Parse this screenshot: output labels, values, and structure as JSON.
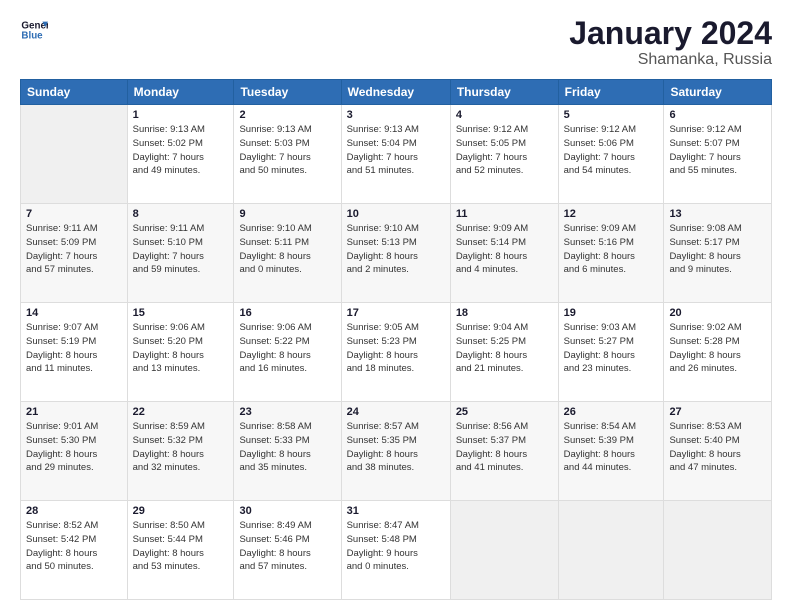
{
  "logo": {
    "line1": "General",
    "line2": "Blue"
  },
  "title": "January 2024",
  "subtitle": "Shamanka, Russia",
  "header_days": [
    "Sunday",
    "Monday",
    "Tuesday",
    "Wednesday",
    "Thursday",
    "Friday",
    "Saturday"
  ],
  "weeks": [
    [
      {
        "day": "",
        "info": ""
      },
      {
        "day": "1",
        "info": "Sunrise: 9:13 AM\nSunset: 5:02 PM\nDaylight: 7 hours\nand 49 minutes."
      },
      {
        "day": "2",
        "info": "Sunrise: 9:13 AM\nSunset: 5:03 PM\nDaylight: 7 hours\nand 50 minutes."
      },
      {
        "day": "3",
        "info": "Sunrise: 9:13 AM\nSunset: 5:04 PM\nDaylight: 7 hours\nand 51 minutes."
      },
      {
        "day": "4",
        "info": "Sunrise: 9:12 AM\nSunset: 5:05 PM\nDaylight: 7 hours\nand 52 minutes."
      },
      {
        "day": "5",
        "info": "Sunrise: 9:12 AM\nSunset: 5:06 PM\nDaylight: 7 hours\nand 54 minutes."
      },
      {
        "day": "6",
        "info": "Sunrise: 9:12 AM\nSunset: 5:07 PM\nDaylight: 7 hours\nand 55 minutes."
      }
    ],
    [
      {
        "day": "7",
        "info": "Sunrise: 9:11 AM\nSunset: 5:09 PM\nDaylight: 7 hours\nand 57 minutes."
      },
      {
        "day": "8",
        "info": "Sunrise: 9:11 AM\nSunset: 5:10 PM\nDaylight: 7 hours\nand 59 minutes."
      },
      {
        "day": "9",
        "info": "Sunrise: 9:10 AM\nSunset: 5:11 PM\nDaylight: 8 hours\nand 0 minutes."
      },
      {
        "day": "10",
        "info": "Sunrise: 9:10 AM\nSunset: 5:13 PM\nDaylight: 8 hours\nand 2 minutes."
      },
      {
        "day": "11",
        "info": "Sunrise: 9:09 AM\nSunset: 5:14 PM\nDaylight: 8 hours\nand 4 minutes."
      },
      {
        "day": "12",
        "info": "Sunrise: 9:09 AM\nSunset: 5:16 PM\nDaylight: 8 hours\nand 6 minutes."
      },
      {
        "day": "13",
        "info": "Sunrise: 9:08 AM\nSunset: 5:17 PM\nDaylight: 8 hours\nand 9 minutes."
      }
    ],
    [
      {
        "day": "14",
        "info": "Sunrise: 9:07 AM\nSunset: 5:19 PM\nDaylight: 8 hours\nand 11 minutes."
      },
      {
        "day": "15",
        "info": "Sunrise: 9:06 AM\nSunset: 5:20 PM\nDaylight: 8 hours\nand 13 minutes."
      },
      {
        "day": "16",
        "info": "Sunrise: 9:06 AM\nSunset: 5:22 PM\nDaylight: 8 hours\nand 16 minutes."
      },
      {
        "day": "17",
        "info": "Sunrise: 9:05 AM\nSunset: 5:23 PM\nDaylight: 8 hours\nand 18 minutes."
      },
      {
        "day": "18",
        "info": "Sunrise: 9:04 AM\nSunset: 5:25 PM\nDaylight: 8 hours\nand 21 minutes."
      },
      {
        "day": "19",
        "info": "Sunrise: 9:03 AM\nSunset: 5:27 PM\nDaylight: 8 hours\nand 23 minutes."
      },
      {
        "day": "20",
        "info": "Sunrise: 9:02 AM\nSunset: 5:28 PM\nDaylight: 8 hours\nand 26 minutes."
      }
    ],
    [
      {
        "day": "21",
        "info": "Sunrise: 9:01 AM\nSunset: 5:30 PM\nDaylight: 8 hours\nand 29 minutes."
      },
      {
        "day": "22",
        "info": "Sunrise: 8:59 AM\nSunset: 5:32 PM\nDaylight: 8 hours\nand 32 minutes."
      },
      {
        "day": "23",
        "info": "Sunrise: 8:58 AM\nSunset: 5:33 PM\nDaylight: 8 hours\nand 35 minutes."
      },
      {
        "day": "24",
        "info": "Sunrise: 8:57 AM\nSunset: 5:35 PM\nDaylight: 8 hours\nand 38 minutes."
      },
      {
        "day": "25",
        "info": "Sunrise: 8:56 AM\nSunset: 5:37 PM\nDaylight: 8 hours\nand 41 minutes."
      },
      {
        "day": "26",
        "info": "Sunrise: 8:54 AM\nSunset: 5:39 PM\nDaylight: 8 hours\nand 44 minutes."
      },
      {
        "day": "27",
        "info": "Sunrise: 8:53 AM\nSunset: 5:40 PM\nDaylight: 8 hours\nand 47 minutes."
      }
    ],
    [
      {
        "day": "28",
        "info": "Sunrise: 8:52 AM\nSunset: 5:42 PM\nDaylight: 8 hours\nand 50 minutes."
      },
      {
        "day": "29",
        "info": "Sunrise: 8:50 AM\nSunset: 5:44 PM\nDaylight: 8 hours\nand 53 minutes."
      },
      {
        "day": "30",
        "info": "Sunrise: 8:49 AM\nSunset: 5:46 PM\nDaylight: 8 hours\nand 57 minutes."
      },
      {
        "day": "31",
        "info": "Sunrise: 8:47 AM\nSunset: 5:48 PM\nDaylight: 9 hours\nand 0 minutes."
      },
      {
        "day": "",
        "info": ""
      },
      {
        "day": "",
        "info": ""
      },
      {
        "day": "",
        "info": ""
      }
    ]
  ]
}
